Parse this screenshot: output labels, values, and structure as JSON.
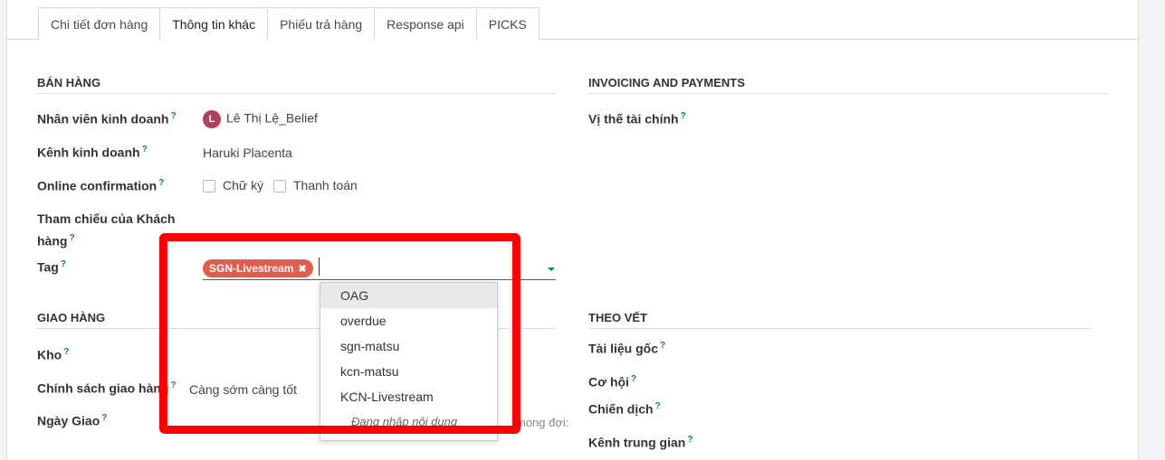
{
  "tabs": [
    "Chi tiết đơn hàng",
    "Thông tin khác",
    "Phiếu trả hàng",
    "Response api",
    "PICKS"
  ],
  "sales": {
    "title": "BÁN HÀNG",
    "salesperson_label": "Nhân viên kinh doanh",
    "salesperson_avatar": "L",
    "salesperson_value": "Lê Thị Lệ_Belief",
    "channel_label": "Kênh kinh doanh",
    "channel_value": "Haruki Placenta",
    "online_conf_label": "Online confirmation",
    "signature_label": "Chữ ký",
    "payment_label": "Thanh toán",
    "customer_ref_label_1": "Tham chiếu của Khách",
    "customer_ref_label_2": "hàng",
    "tag_label": "Tag",
    "tag_chip": "SGN-Livestream",
    "tag_remove": "✖"
  },
  "tag_dropdown": {
    "items": [
      "OAG",
      "overdue",
      "sgn-matsu",
      "kcn-matsu",
      "KCN-Livestream"
    ],
    "search_text": "Đang nhập nội dung"
  },
  "invoicing": {
    "title": "INVOICING AND PAYMENTS",
    "fiscal_label": "Vị thế tài chính"
  },
  "delivery": {
    "title": "GIAO HÀNG",
    "warehouse_label": "Kho",
    "policy_label": "Chính sách giao hàng",
    "policy_value": "Càng sớm càng tốt",
    "date_label": "Ngày Giao",
    "date_hint": "mong đợi:"
  },
  "tracking": {
    "title": "THEO VẾT",
    "source_label": "Tài liệu gốc",
    "opportunity_label": "Cơ hội",
    "campaign_label": "Chiến dịch",
    "medium_label": "Kênh trung gian"
  },
  "help_mark": "?",
  "colors": {
    "accent": "#0b7b8a",
    "tag": "#e35d4d",
    "highlight": "#ff0000"
  }
}
